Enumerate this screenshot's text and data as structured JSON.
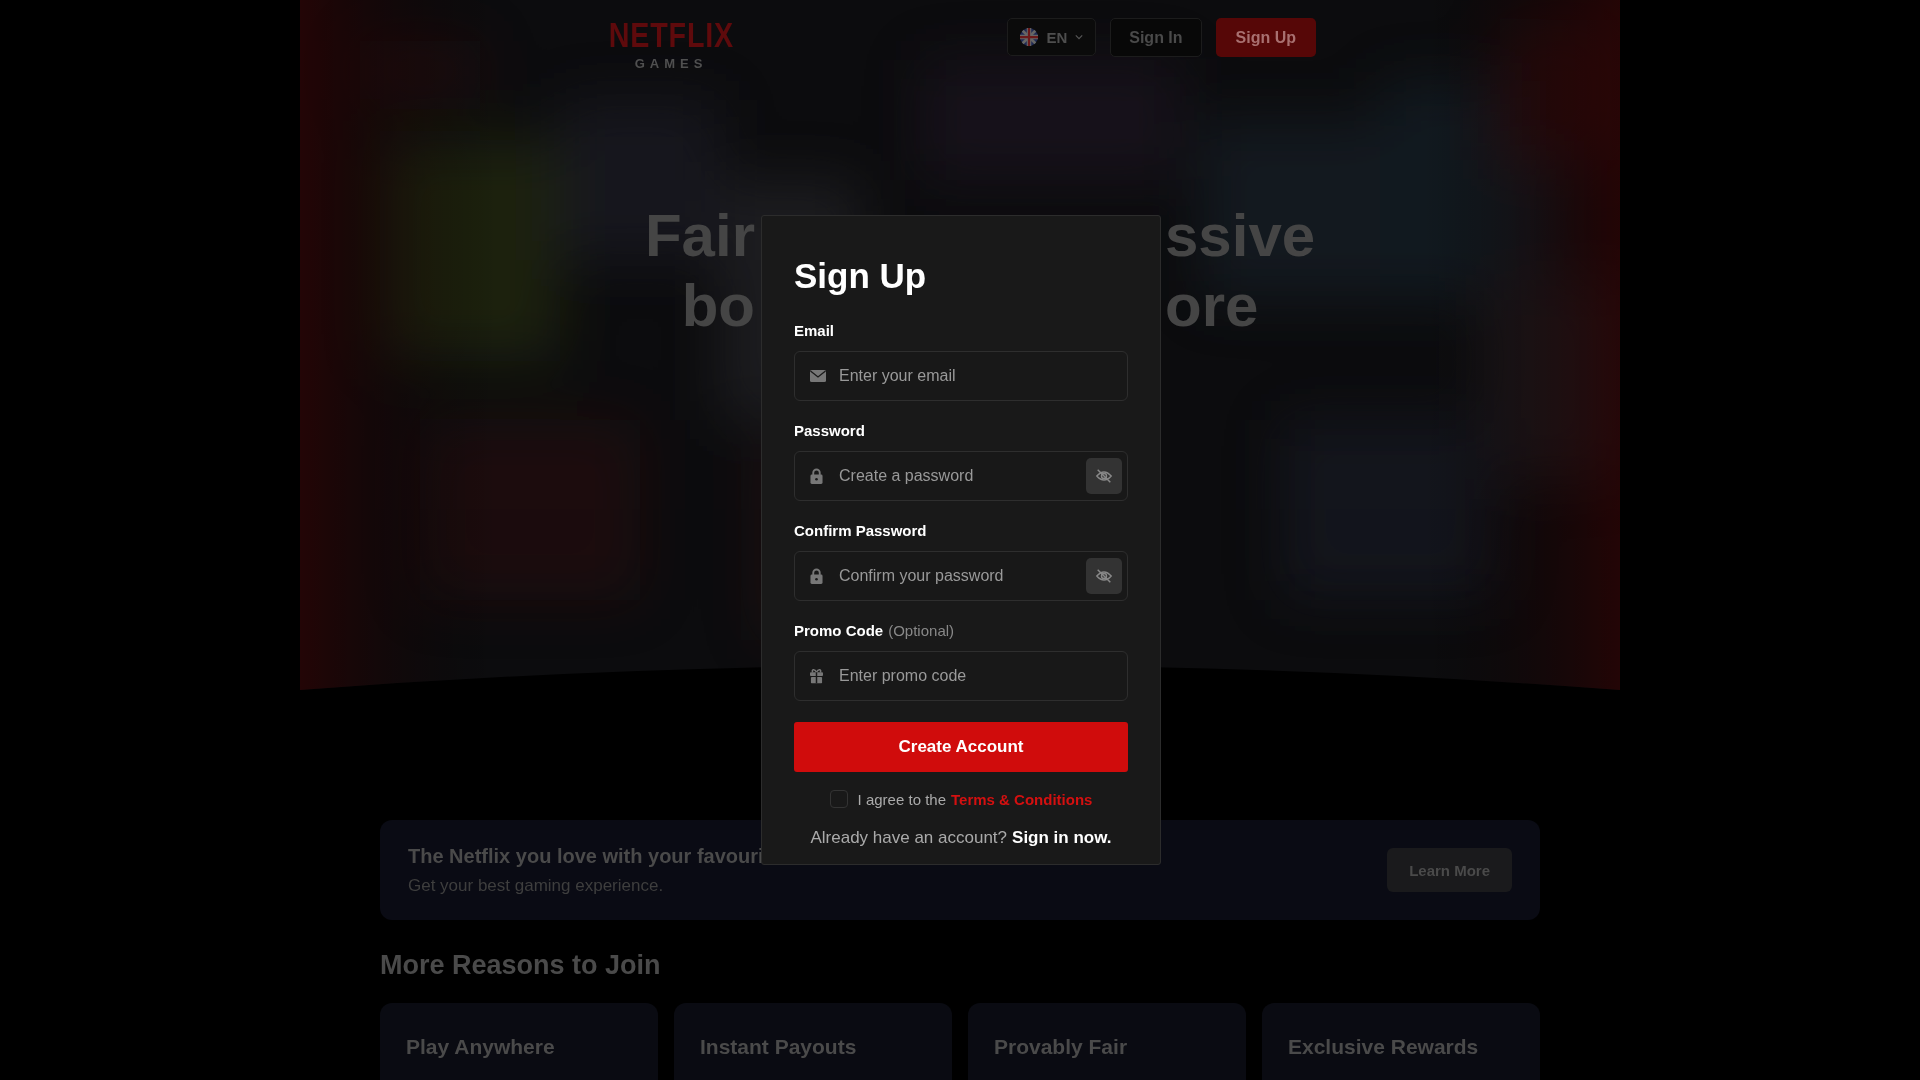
{
  "header": {
    "logo": {
      "wordmark": "NETFLIX",
      "subtitle": "GAMES"
    },
    "language": {
      "code": "EN"
    },
    "buttons": [
      {
        "label": "Sign In",
        "kind": "outline"
      },
      {
        "label": "Sign Up",
        "kind": "primary"
      }
    ]
  },
  "hero": {
    "lines": [
      {
        "left": "Fair",
        "right": "ssive"
      },
      {
        "left": "bo",
        "right": "ore"
      }
    ]
  },
  "promo_banner": {
    "title": "The Netflix you love with your favouri",
    "subtitle": "Get your best gaming experience.",
    "button": "Learn More"
  },
  "reasons": {
    "heading": "More Reasons to Join",
    "cards": [
      {
        "title": "Play Anywhere"
      },
      {
        "title": "Instant Payouts"
      },
      {
        "title": "Provably Fair"
      },
      {
        "title": "Exclusive Rewards"
      }
    ]
  },
  "modal": {
    "title": "Sign Up",
    "fields": [
      {
        "label": "Email",
        "kind": "mail",
        "placeholder": "Enter your email",
        "toggle": false
      },
      {
        "label": "Password",
        "kind": "lock",
        "placeholder": "Create a password",
        "toggle": true
      },
      {
        "label": "Confirm Password",
        "kind": "lock",
        "placeholder": "Confirm your password",
        "toggle": true
      },
      {
        "label": "Promo Code",
        "note": "(Optional)",
        "kind": "gift",
        "placeholder": "Enter promo code",
        "toggle": false
      }
    ],
    "submit": "Create Account",
    "terms": {
      "checked": false,
      "text": "I agree to the",
      "link": "Terms & Conditions"
    },
    "signin": {
      "text": "Already have an account?",
      "link": "Sign in now."
    }
  }
}
